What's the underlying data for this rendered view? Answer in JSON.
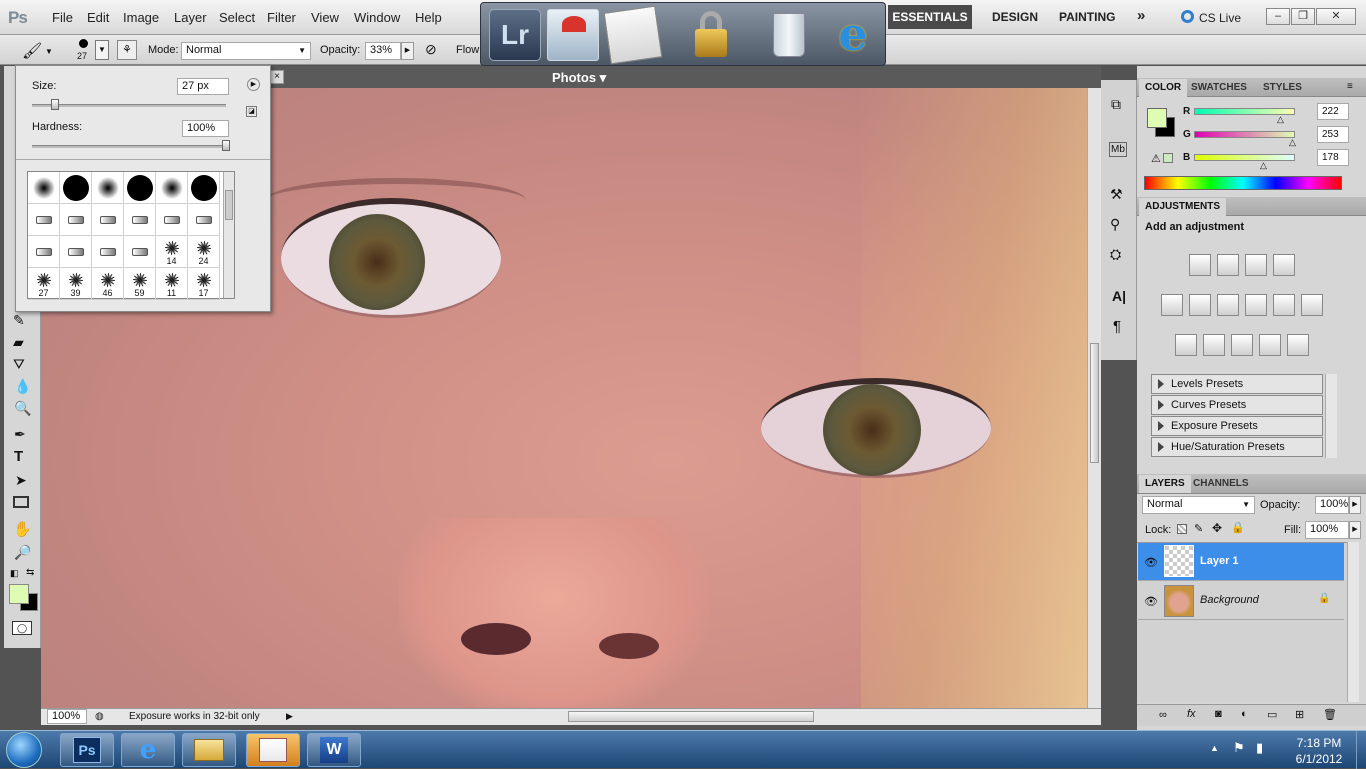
{
  "app": {
    "logo": "Ps"
  },
  "menu": [
    "File",
    "Edit",
    "Image",
    "Layer",
    "Select",
    "Filter",
    "View",
    "Window",
    "Help"
  ],
  "workspaces": {
    "active": "ESSENTIALS",
    "design": "DESIGN",
    "painting": "PAINTING",
    "more": "»",
    "cslive": "CS Live"
  },
  "options": {
    "brush_size_label": "27",
    "mode_label": "Mode:",
    "mode_value": "Normal",
    "opacity_label": "Opacity:",
    "opacity_value": "33%",
    "flow_label": "Flow"
  },
  "dock": {
    "lr_label": "Lr",
    "items": [
      "lightroom-icon",
      "photo-album-icon",
      "documents-icon",
      "lock-icon",
      "recycle-bin-icon",
      "internet-explorer-icon"
    ]
  },
  "document": {
    "title": "Photos ▾",
    "zoom": "100%",
    "status": "Exposure works in 32-bit only",
    "tab_close": "×"
  },
  "brush_popup": {
    "size_label": "Size:",
    "size_value": "27 px",
    "size_fraction": 0.1,
    "hardness_label": "Hardness:",
    "hardness_value": "100%",
    "hardness_fraction": 1.0,
    "brushes": [
      {
        "kind": "soft",
        "num": ""
      },
      {
        "kind": "hard",
        "num": ""
      },
      {
        "kind": "soft",
        "num": ""
      },
      {
        "kind": "hard",
        "num": ""
      },
      {
        "kind": "soft",
        "num": ""
      },
      {
        "kind": "hard",
        "num": ""
      },
      {
        "kind": "tip",
        "num": ""
      },
      {
        "kind": "tip",
        "num": ""
      },
      {
        "kind": "tip",
        "num": ""
      },
      {
        "kind": "tip",
        "num": ""
      },
      {
        "kind": "tip",
        "num": ""
      },
      {
        "kind": "tip",
        "num": ""
      },
      {
        "kind": "tip",
        "num": ""
      },
      {
        "kind": "tip",
        "num": ""
      },
      {
        "kind": "tip",
        "num": ""
      },
      {
        "kind": "tip",
        "num": ""
      },
      {
        "kind": "splat",
        "num": "14"
      },
      {
        "kind": "splat",
        "num": "24"
      },
      {
        "kind": "splat",
        "num": "27"
      },
      {
        "kind": "splat",
        "num": "39"
      },
      {
        "kind": "splat",
        "num": "46"
      },
      {
        "kind": "splat",
        "num": "59"
      },
      {
        "kind": "splat",
        "num": "11"
      },
      {
        "kind": "splat",
        "num": "17"
      }
    ]
  },
  "color_panel": {
    "tabs": [
      "COLOR",
      "SWATCHES",
      "STYLES"
    ],
    "r_label": "R",
    "g_label": "G",
    "b_label": "B",
    "r": "222",
    "g": "253",
    "b": "178",
    "r_fraction": 0.87,
    "g_fraction": 0.99,
    "b_fraction": 0.7,
    "fg_color": "#defdb2",
    "bg_color": "#000000"
  },
  "adjustments": {
    "tab": "ADJUSTMENTS",
    "heading": "Add an adjustment",
    "presets": [
      "Levels Presets",
      "Curves Presets",
      "Exposure Presets",
      "Hue/Saturation Presets"
    ]
  },
  "layers": {
    "tabs": [
      "LAYERS",
      "CHANNELS"
    ],
    "blend": "Normal",
    "opacity_label": "Opacity:",
    "opacity": "100%",
    "lock_label": "Lock:",
    "fill_label": "Fill:",
    "fill": "100%",
    "items": [
      {
        "name": "Layer 1"
      },
      {
        "name": "Background"
      }
    ]
  },
  "taskbar": {
    "time": "7:18 PM",
    "date": "6/1/2012",
    "ps_label": "Ps",
    "word_label": "W"
  }
}
